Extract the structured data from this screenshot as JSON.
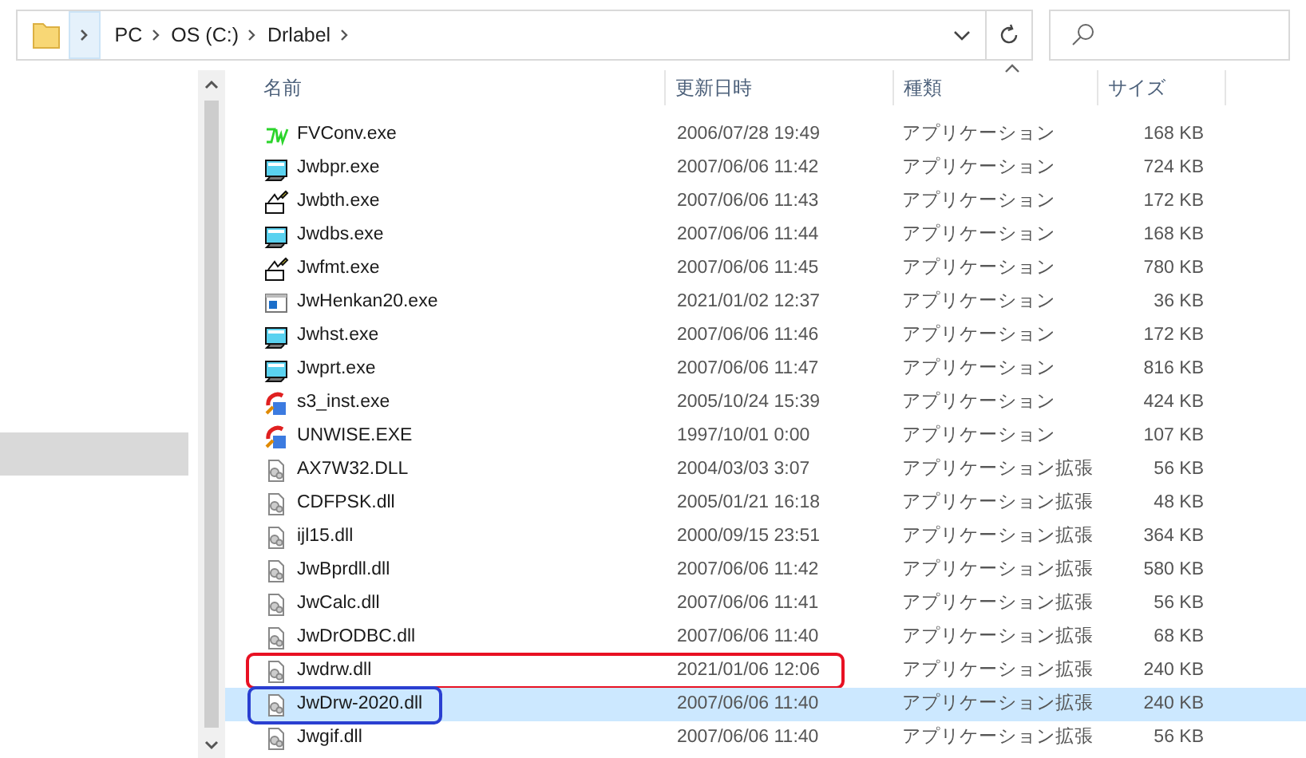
{
  "address_bar": {
    "breadcrumbs": [
      "PC",
      "OS (C:)",
      "Drlabel"
    ]
  },
  "columns": [
    {
      "label": "名前",
      "sorted": false
    },
    {
      "label": "更新日時",
      "sorted": false
    },
    {
      "label": "種類",
      "sorted": true
    },
    {
      "label": "サイズ",
      "sorted": false
    }
  ],
  "rows": [
    {
      "kind": "jw",
      "name": "FVConv.exe",
      "date": "2006/07/28 19:49",
      "type": "アプリケーション",
      "size": "168 KB",
      "selected": false
    },
    {
      "kind": "app",
      "name": "Jwbpr.exe",
      "date": "2007/06/06 11:42",
      "type": "アプリケーション",
      "size": "724 KB",
      "selected": false
    },
    {
      "kind": "pen",
      "name": "Jwbth.exe",
      "date": "2007/06/06 11:43",
      "type": "アプリケーション",
      "size": "172 KB",
      "selected": false
    },
    {
      "kind": "app",
      "name": "Jwdbs.exe",
      "date": "2007/06/06 11:44",
      "type": "アプリケーション",
      "size": "168 KB",
      "selected": false
    },
    {
      "kind": "pen",
      "name": "Jwfmt.exe",
      "date": "2007/06/06 11:45",
      "type": "アプリケーション",
      "size": "780 KB",
      "selected": false
    },
    {
      "kind": "window",
      "name": "JwHenkan20.exe",
      "date": "2021/01/02 12:37",
      "type": "アプリケーション",
      "size": "36 KB",
      "selected": false
    },
    {
      "kind": "app",
      "name": "Jwhst.exe",
      "date": "2007/06/06 11:46",
      "type": "アプリケーション",
      "size": "172 KB",
      "selected": false
    },
    {
      "kind": "app",
      "name": "Jwprt.exe",
      "date": "2007/06/06 11:47",
      "type": "アプリケーション",
      "size": "816 KB",
      "selected": false
    },
    {
      "kind": "setup",
      "name": "s3_inst.exe",
      "date": "2005/10/24 15:39",
      "type": "アプリケーション",
      "size": "424 KB",
      "selected": false
    },
    {
      "kind": "setup",
      "name": "UNWISE.EXE",
      "date": "1997/10/01 0:00",
      "type": "アプリケーション",
      "size": "107 KB",
      "selected": false
    },
    {
      "kind": "dll",
      "name": "AX7W32.DLL",
      "date": "2004/03/03 3:07",
      "type": "アプリケーション拡張",
      "size": "56 KB",
      "selected": false
    },
    {
      "kind": "dll",
      "name": "CDFPSK.dll",
      "date": "2005/01/21 16:18",
      "type": "アプリケーション拡張",
      "size": "48 KB",
      "selected": false
    },
    {
      "kind": "dll",
      "name": "ijl15.dll",
      "date": "2000/09/15 23:51",
      "type": "アプリケーション拡張",
      "size": "364 KB",
      "selected": false
    },
    {
      "kind": "dll",
      "name": "JwBprdll.dll",
      "date": "2007/06/06 11:42",
      "type": "アプリケーション拡張",
      "size": "580 KB",
      "selected": false
    },
    {
      "kind": "dll",
      "name": "JwCalc.dll",
      "date": "2007/06/06 11:41",
      "type": "アプリケーション拡張",
      "size": "56 KB",
      "selected": false
    },
    {
      "kind": "dll",
      "name": "JwDrODBC.dll",
      "date": "2007/06/06 11:40",
      "type": "アプリケーション拡張",
      "size": "68 KB",
      "selected": false
    },
    {
      "kind": "dll",
      "name": "Jwdrw.dll",
      "date": "2021/01/06 12:06",
      "type": "アプリケーション拡張",
      "size": "240 KB",
      "selected": false,
      "annotation": {
        "kind": "row",
        "color": "#e81123"
      }
    },
    {
      "kind": "dll",
      "name": "JwDrw-2020.dll",
      "date": "2007/06/06 11:40",
      "type": "アプリケーション拡張",
      "size": "240 KB",
      "selected": true,
      "annotation": {
        "kind": "name",
        "color": "#2a3fd1"
      }
    },
    {
      "kind": "dll",
      "name": "Jwgif.dll",
      "date": "2007/06/06 11:40",
      "type": "アプリケーション拡張",
      "size": "56 KB",
      "selected": false
    }
  ]
}
